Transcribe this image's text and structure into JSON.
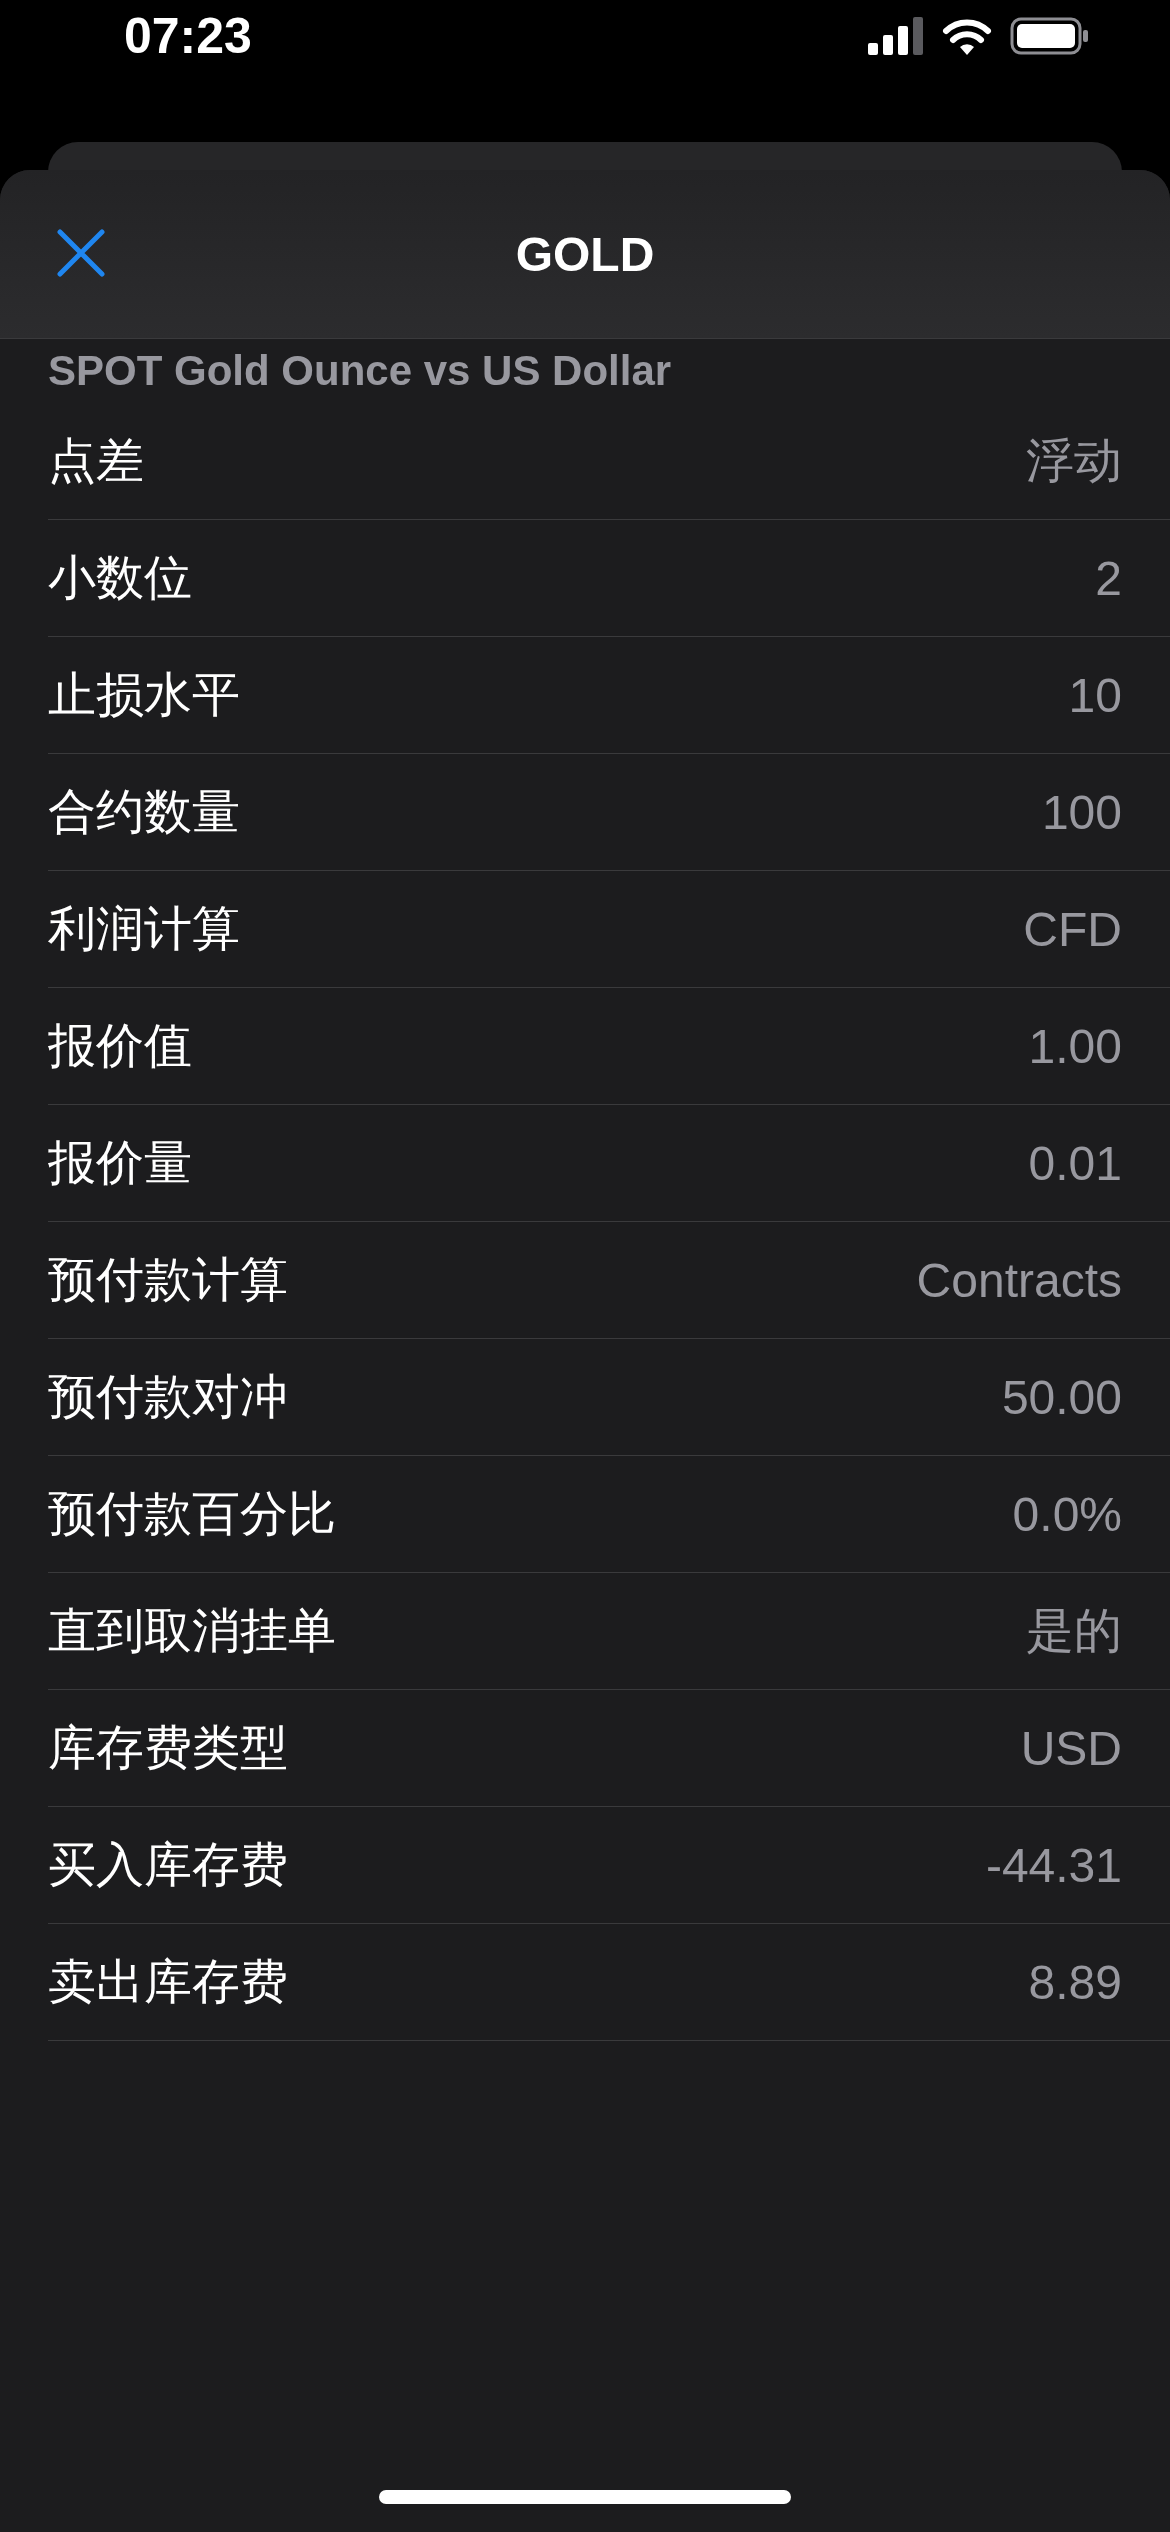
{
  "status_bar": {
    "time": "07:23"
  },
  "header": {
    "title": "GOLD"
  },
  "section": {
    "title": "SPOT Gold Ounce vs US Dollar"
  },
  "rows": [
    {
      "label": "点差",
      "value": "浮动"
    },
    {
      "label": "小数位",
      "value": "2"
    },
    {
      "label": "止损水平",
      "value": "10"
    },
    {
      "label": "合约数量",
      "value": "100"
    },
    {
      "label": "利润计算",
      "value": "CFD"
    },
    {
      "label": "报价值",
      "value": "1.00"
    },
    {
      "label": "报价量",
      "value": "0.01"
    },
    {
      "label": "预付款计算",
      "value": "Contracts"
    },
    {
      "label": "预付款对冲",
      "value": "50.00"
    },
    {
      "label": "预付款百分比",
      "value": "0.0%"
    },
    {
      "label": "直到取消挂单",
      "value": "是的"
    },
    {
      "label": "库存费类型",
      "value": "USD"
    },
    {
      "label": "买入库存费",
      "value": "-44.31"
    },
    {
      "label": "卖出库存费",
      "value": "8.89"
    }
  ]
}
